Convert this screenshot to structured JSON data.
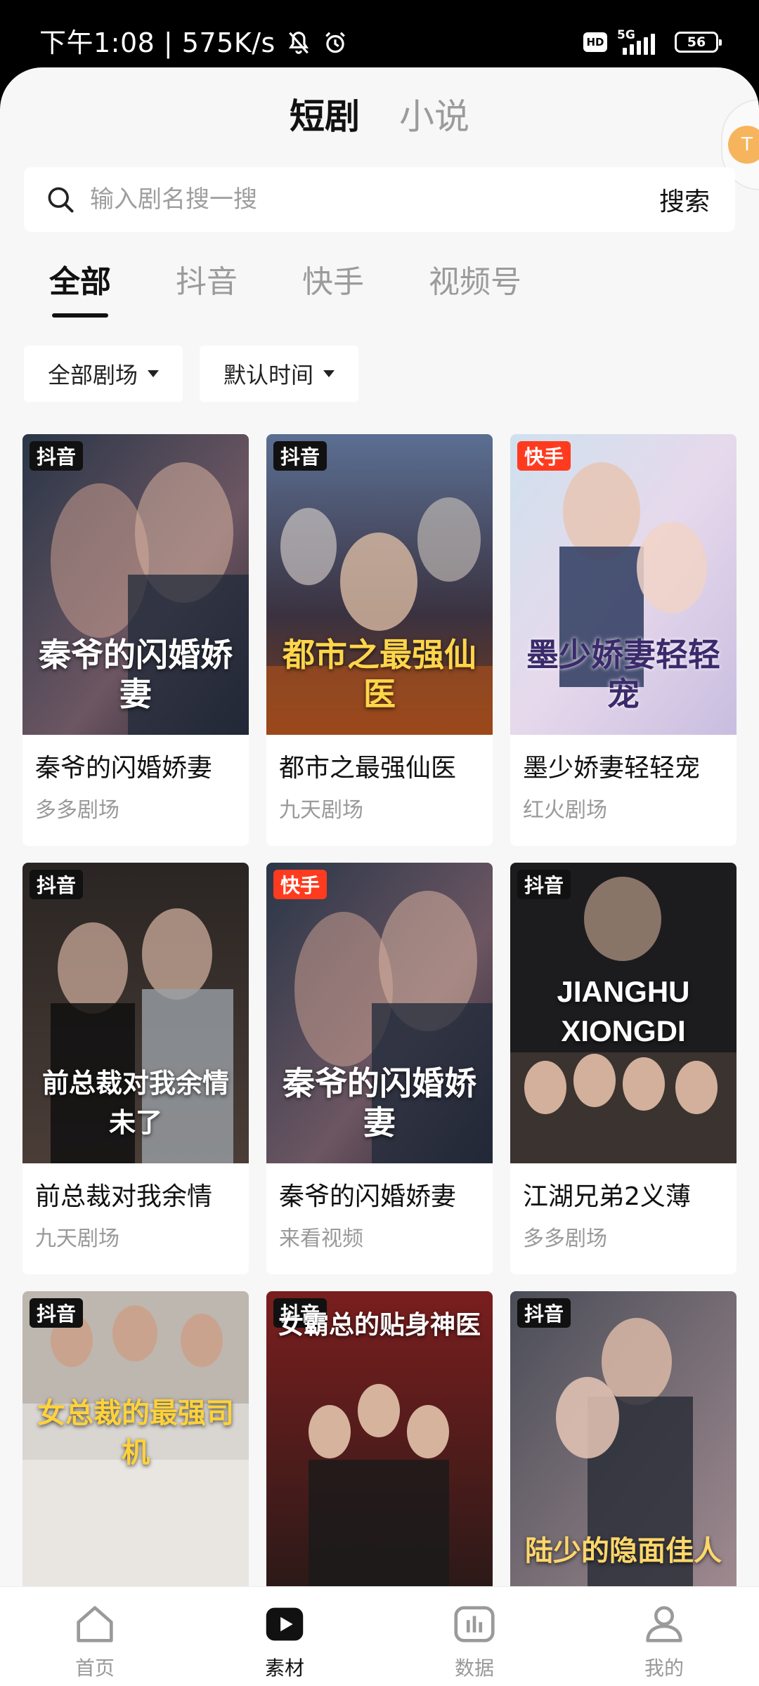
{
  "status_bar": {
    "time": "下午1:08 | 575K/s",
    "hd": "HD",
    "network": "5G",
    "battery": "56"
  },
  "top_tabs": [
    {
      "label": "短剧",
      "active": true
    },
    {
      "label": "小说",
      "active": false
    }
  ],
  "search": {
    "placeholder": "输入剧名搜一搜",
    "button": "搜索"
  },
  "platform_tabs": [
    {
      "label": "全部",
      "active": true
    },
    {
      "label": "抖音",
      "active": false
    },
    {
      "label": "快手",
      "active": false
    },
    {
      "label": "视频号",
      "active": false
    }
  ],
  "filters": {
    "theater": "全部剧场",
    "sort": "默认时间"
  },
  "cards": [
    {
      "badge": "抖音",
      "poster_text": "秦爷的闪婚娇妻",
      "title": "秦爷的闪婚娇妻",
      "theater": "多多剧场"
    },
    {
      "badge": "抖音",
      "poster_text": "都市之最强仙医",
      "title": "都市之最强仙医",
      "theater": "九天剧场"
    },
    {
      "badge": "快手",
      "poster_text": "墨少娇妻轻轻宠",
      "title": "墨少娇妻轻轻宠",
      "theater": "红火剧场"
    },
    {
      "badge": "抖音",
      "poster_text": "前总裁对我余情未了",
      "title": "前总裁对我余情",
      "theater": "九天剧场"
    },
    {
      "badge": "快手",
      "poster_text": "秦爷的闪婚娇妻",
      "title": "秦爷的闪婚娇妻",
      "theater": "来看视频"
    },
    {
      "badge": "抖音",
      "poster_text": "JIANGHU XIONGDI",
      "title": "江湖兄弟2义薄",
      "theater": "多多剧场"
    },
    {
      "badge": "抖音",
      "poster_text": "女总裁的最强司机",
      "title": "",
      "theater": ""
    },
    {
      "badge": "抖音",
      "poster_text": "女霸总的贴身神医",
      "title": "",
      "theater": ""
    },
    {
      "badge": "抖音",
      "poster_text": "陆少的隐面佳人",
      "title": "",
      "theater": ""
    }
  ],
  "bottom_nav": [
    {
      "label": "首页",
      "icon": "home-icon",
      "active": false
    },
    {
      "label": "素材",
      "icon": "play-icon",
      "active": true
    },
    {
      "label": "数据",
      "icon": "chart-icon",
      "active": false
    },
    {
      "label": "我的",
      "icon": "user-icon",
      "active": false
    }
  ],
  "colors": {
    "douyin_badge": "#111111",
    "kuaishou_badge": "#ff3b1f",
    "background": "#f7f7f7"
  }
}
